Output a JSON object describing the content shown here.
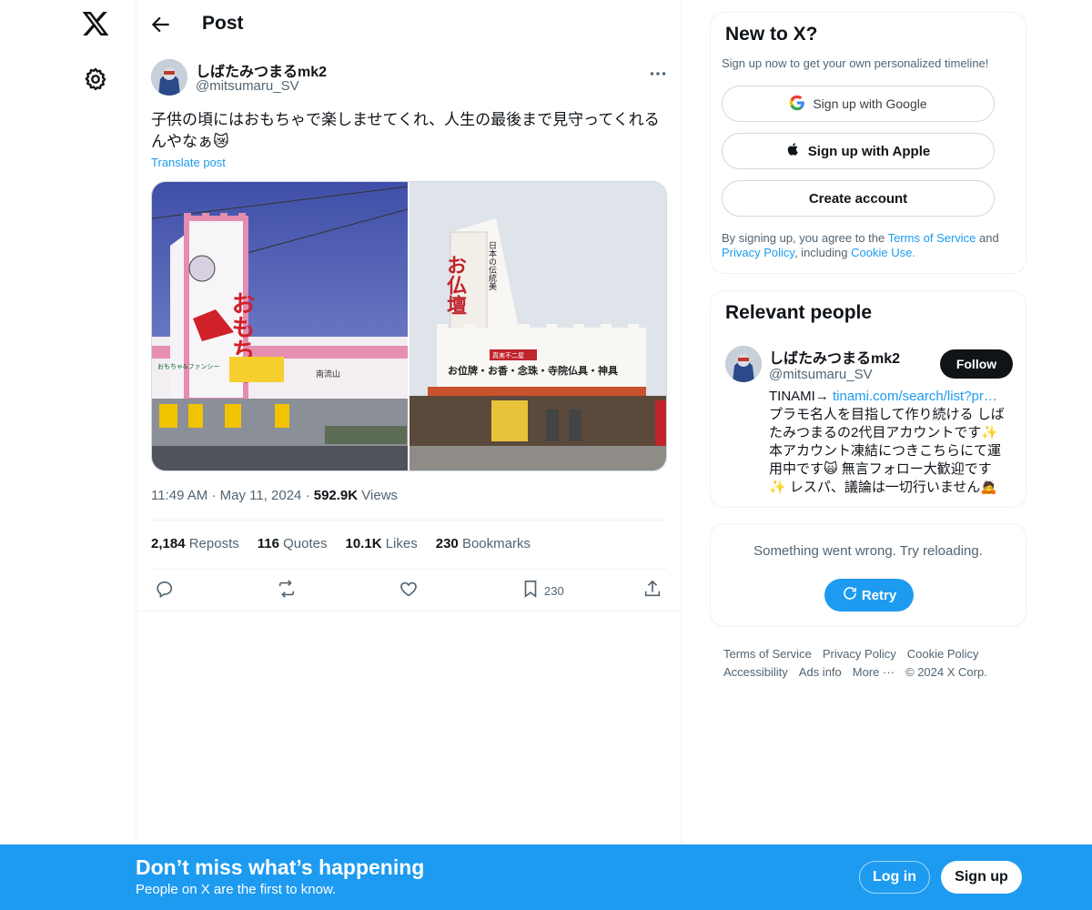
{
  "nav": {
    "logo_icon": "x-logo-icon",
    "settings_icon": "gear-icon"
  },
  "header": {
    "title": "Post",
    "back_icon": "arrow-left-icon"
  },
  "post": {
    "author_name": "しばたみつまるmk2",
    "author_handle": "@mitsumaru_SV",
    "text": "子供の頃にはおもちゃで楽しませてくれ、人生の最後まで見守ってくれるんやなぁ😿",
    "translate": "Translate post",
    "time": "11:49 AM",
    "date": "May 11, 2024",
    "views_count": "592.9K",
    "views_label": "Views",
    "reposts_count": "2,184",
    "reposts_label": "Reposts",
    "quotes_count": "116",
    "quotes_label": "Quotes",
    "likes_count": "10.1K",
    "likes_label": "Likes",
    "bookmarks_count": "230",
    "bookmarks_label": "Bookmarks",
    "bookmark_action_count": "230",
    "image1": {
      "sign_main": "おもちゃ",
      "sign_small": "おもちゃ&ファンシー",
      "sign_right": "南流山"
    },
    "image2": {
      "sign_main": "お仏壇",
      "sign_vertical": "日本の伝統美",
      "sign_red": "真実不二屋",
      "sign_band": "お位牌・お香・念珠・寺院仏具・神具"
    }
  },
  "signup_card": {
    "title": "New to X?",
    "subtitle": "Sign up now to get your own personalized timeline!",
    "google": "Sign up with Google",
    "apple": "Sign up with Apple",
    "create": "Create account",
    "legal_1": "By signing up, you agree to the ",
    "legal_tos": "Terms of Service",
    "legal_2": " and ",
    "legal_privacy": "Privacy Policy",
    "legal_3": ", including ",
    "legal_cookie": "Cookie Use."
  },
  "relevant": {
    "title": "Relevant people",
    "name": "しばたみつまるmk2",
    "handle": "@mitsumaru_SV",
    "follow": "Follow",
    "bio_prefix": "TINAMI→ ",
    "bio_link": "tinami.com/search/list?pr…",
    "bio_line2": "プラモ名人を目指して作り続ける しば",
    "bio_line3": "たみつまるの2代目アカウントです✨",
    "bio_line4": "本アカウント凍結につきこちらにて運",
    "bio_line5": "用中です🙀 無言フォロー大歓迎です",
    "bio_line6": "✨ レスパ、議論は一切行いません🙇"
  },
  "error_card": {
    "message": "Something went wrong. Try reloading.",
    "retry": "Retry"
  },
  "footer": {
    "tos": "Terms of Service",
    "privacy": "Privacy Policy",
    "cookie": "Cookie Policy",
    "accessibility": "Accessibility",
    "ads": "Ads info",
    "more": "More ···",
    "copyright": "© 2024 X Corp."
  },
  "banner": {
    "headline": "Don’t miss what’s happening",
    "sub": "People on X are the first to know.",
    "login": "Log in",
    "signup": "Sign up"
  },
  "colors": {
    "accent": "#1d9bf0",
    "text": "#0f1419",
    "muted": "#536471"
  }
}
